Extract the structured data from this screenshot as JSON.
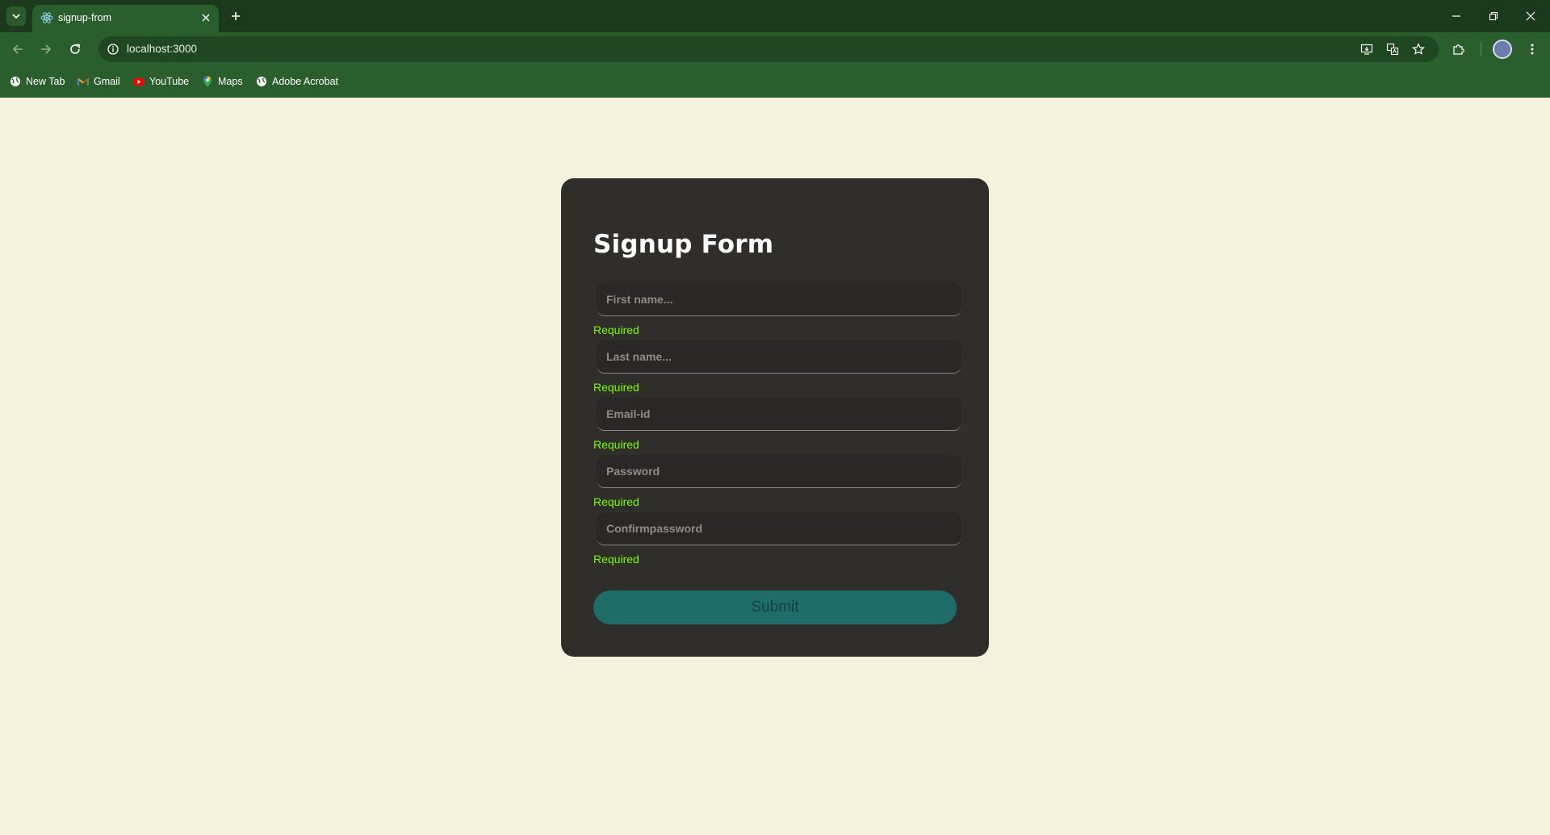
{
  "browser": {
    "tab": {
      "title": "signup-from",
      "favicon": "react-atom-icon"
    },
    "url": "localhost:3000",
    "bookmarks": [
      {
        "label": "New Tab",
        "icon": "globe-icon"
      },
      {
        "label": "Gmail",
        "icon": "gmail-icon"
      },
      {
        "label": "YouTube",
        "icon": "youtube-icon"
      },
      {
        "label": "Maps",
        "icon": "maps-pin-icon"
      },
      {
        "label": "Adobe Acrobat",
        "icon": "globe-icon"
      }
    ],
    "colors": {
      "frame": "#1b3a1d",
      "toolbar": "#2a5e2d"
    }
  },
  "form": {
    "title": "Signup Form",
    "fields": [
      {
        "placeholder": "First name...",
        "value": "",
        "error": "Required"
      },
      {
        "placeholder": "Last name...",
        "value": "",
        "error": "Required"
      },
      {
        "placeholder": "Email-id",
        "value": "",
        "error": "Required"
      },
      {
        "placeholder": "Password",
        "value": "",
        "error": "Required"
      },
      {
        "placeholder": "Confirmpassword",
        "value": "",
        "error": "Required"
      }
    ],
    "submit_label": "Submit",
    "colors": {
      "page": "#f4f2dc",
      "card": "#2f2e2b",
      "error": "#7cfc00",
      "button": "#1f6d6a"
    }
  }
}
